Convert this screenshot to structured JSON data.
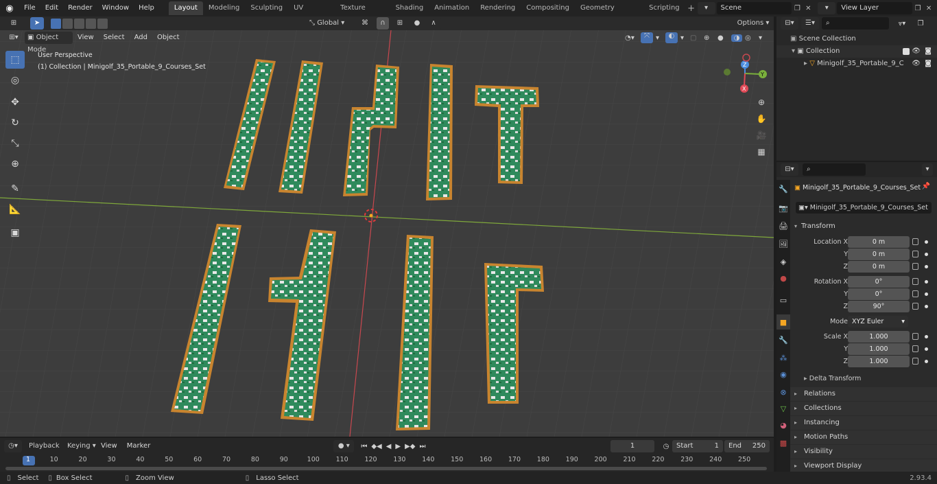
{
  "menu": [
    "File",
    "Edit",
    "Render",
    "Window",
    "Help"
  ],
  "workspaces": [
    "Layout",
    "Modeling",
    "Sculpting",
    "UV Editing",
    "Texture Paint",
    "Shading",
    "Animation",
    "Rendering",
    "Compositing",
    "Geometry Nodes",
    "Scripting"
  ],
  "scene_name": "Scene",
  "view_layer": "View Layer",
  "viewport": {
    "mode": "Object Mode",
    "menus": [
      "View",
      "Select",
      "Add",
      "Object"
    ],
    "orientation": "Global",
    "options": "Options",
    "perspective": "User Perspective",
    "collection_info": "(1) Collection | Minigolf_35_Portable_9_Courses_Set",
    "gizmo": {
      "x": "X",
      "y": "Y",
      "z": "Z"
    }
  },
  "outliner": {
    "scene_collection": "Scene Collection",
    "collection": "Collection",
    "object": "Minigolf_35_Portable_9_C"
  },
  "properties": {
    "object_name": "Minigolf_35_Portable_9_Courses_Set",
    "data_name": "Minigolf_35_Portable_9_Courses_Set",
    "transform_label": "Transform",
    "location_label": "Location X",
    "rotation_label": "Rotation X",
    "scale_label": "Scale X",
    "y_label": "Y",
    "z_label": "Z",
    "location": [
      "0 m",
      "0 m",
      "0 m"
    ],
    "rotation": [
      "0°",
      "0°",
      "90°"
    ],
    "mode_label": "Mode",
    "mode_value": "XYZ Euler",
    "scale": [
      "1.000",
      "1.000",
      "1.000"
    ],
    "delta": "Delta Transform",
    "panels": [
      "Relations",
      "Collections",
      "Instancing",
      "Motion Paths",
      "Visibility",
      "Viewport Display"
    ]
  },
  "timeline": {
    "menus": [
      "Playback",
      "Keying",
      "View",
      "Marker"
    ],
    "current_frame": "1",
    "start_label": "Start",
    "start": "1",
    "end_label": "End",
    "end": "250",
    "ticks": [
      "1",
      "10",
      "20",
      "30",
      "40",
      "50",
      "60",
      "70",
      "80",
      "90",
      "100",
      "110",
      "120",
      "130",
      "140",
      "150",
      "160",
      "170",
      "180",
      "190",
      "200",
      "210",
      "220",
      "230",
      "240",
      "250"
    ]
  },
  "status": {
    "select": "Select",
    "box_select": "Box Select",
    "zoom": "Zoom View",
    "lasso": "Lasso Select",
    "version": "2.93.4"
  }
}
